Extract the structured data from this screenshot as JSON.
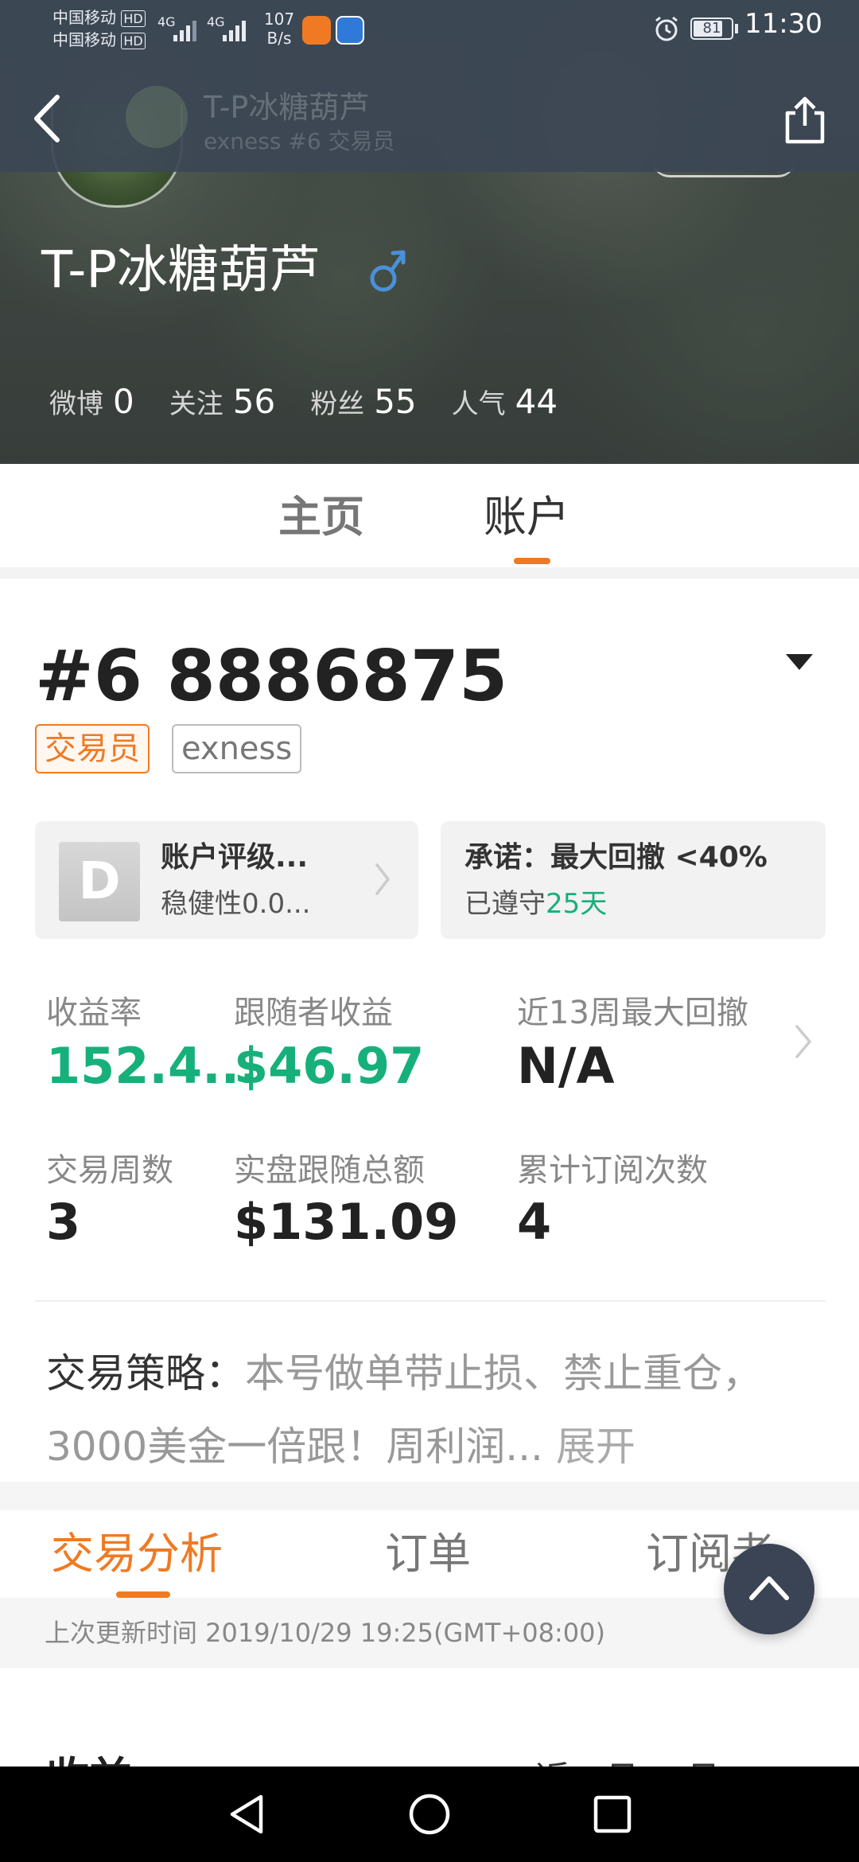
{
  "status_bar": {
    "carrier1": "中国移动",
    "carrier2": "中国移动",
    "hd1": "HD",
    "hd2": "HD",
    "net1": "4G",
    "net2": "4G",
    "speed": "107",
    "speed_unit": "B/s",
    "battery": "81",
    "time": "11:30"
  },
  "nav": {
    "title_faded": "T-P冰糖葫芦",
    "subtitle_faded": "exness #6 交易员"
  },
  "profile": {
    "name": "T-P冰糖葫芦",
    "gender_symbol": "♂",
    "stats": [
      {
        "label": "微博",
        "value": "0"
      },
      {
        "label": "关注",
        "value": "56"
      },
      {
        "label": "粉丝",
        "value": "55"
      },
      {
        "label": "人气",
        "value": "44"
      }
    ]
  },
  "tabs": {
    "home": "主页",
    "account": "账户"
  },
  "account": {
    "number": "#6 8886875",
    "badge_role": "交易员",
    "badge_broker": "exness",
    "rating_letter": "D",
    "rating_title": "账户评级...",
    "rating_sub": "稳健性0.0...",
    "promise_title": "承诺：最大回撤 <40%",
    "promise_prefix": "已遵守",
    "promise_days": "25天"
  },
  "metrics": {
    "yield_label": "收益率",
    "yield_value": "152.4...",
    "follower_profit_label": "跟随者收益",
    "follower_profit_value": "$46.97",
    "max_drawdown_label": "近13周最大回撤",
    "max_drawdown_value": "N/A",
    "weeks_label": "交易周数",
    "weeks_value": "3",
    "follow_total_label": "实盘跟随总额",
    "follow_total_value": "$131.09",
    "subs_label": "累计订阅次数",
    "subs_value": "4"
  },
  "strategy": {
    "label": "交易策略：",
    "text": "本号做单带止损、禁止重仓，3000美金一倍跟！周利润...",
    "expand": "展开"
  },
  "subtabs": {
    "analysis": "交易分析",
    "orders": "订单",
    "subscribers": "订阅者"
  },
  "update": {
    "text": "上次更新时间 2019/10/29 19:25(GMT+08:00)"
  },
  "bottom_peek": {
    "left": "收益",
    "right": "近一月 一月"
  },
  "colors": {
    "accent_orange": "#f07a23",
    "profit_green": "#17b07a",
    "topbar": "#3c4655",
    "male_blue": "#4a90d9"
  },
  "icons": {
    "back": "chevron-left",
    "share": "share-box-arrow",
    "dropdown": "triangle-down",
    "fab": "chevron-up"
  }
}
